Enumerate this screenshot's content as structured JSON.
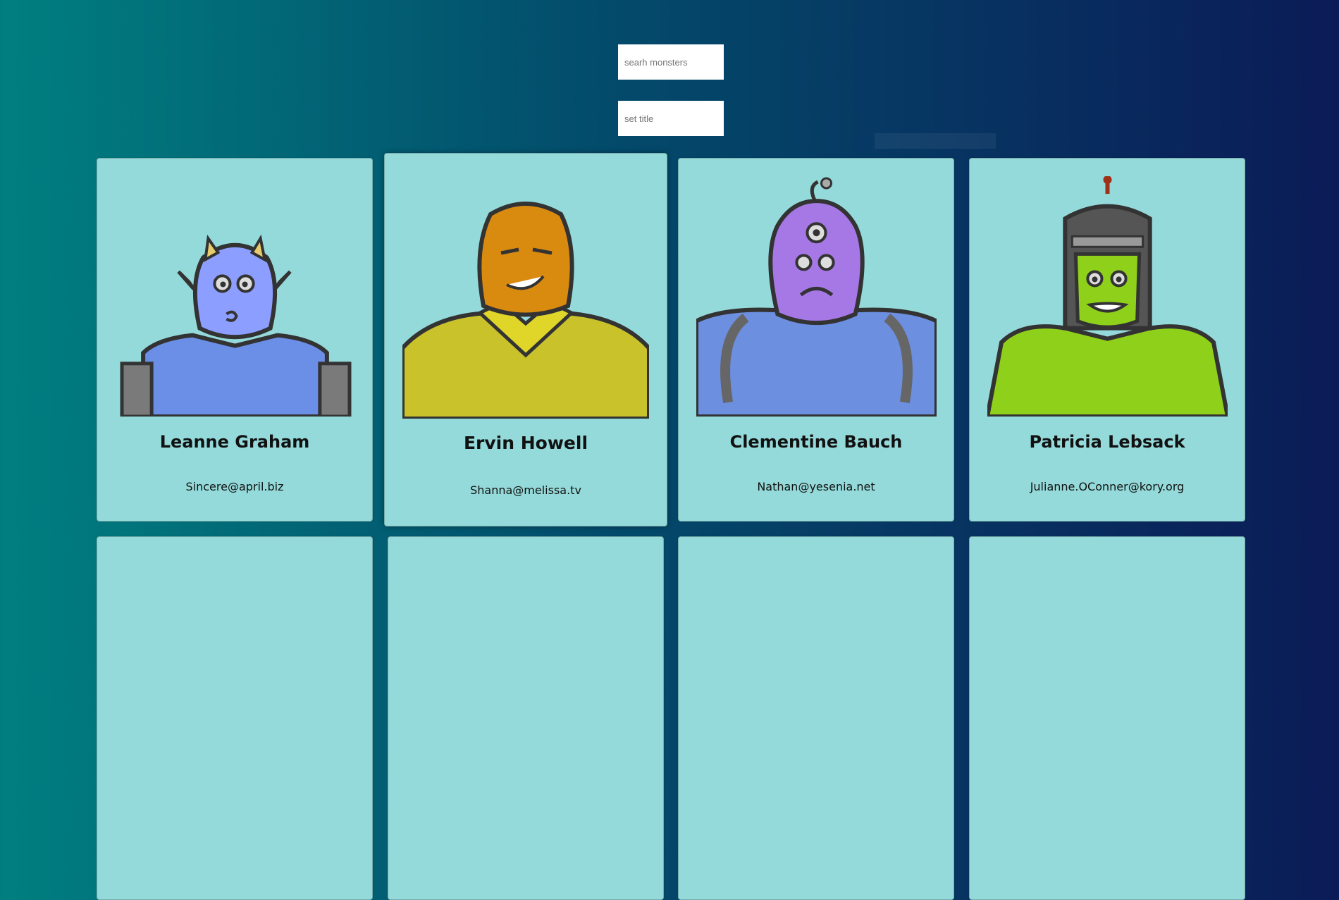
{
  "search": {
    "placeholder": "searh monsters"
  },
  "title_field": {
    "placeholder": "set title"
  },
  "monsters": [
    {
      "name": "Leanne Graham",
      "email": "Sincere@april.biz",
      "color": "#8c9eff"
    },
    {
      "name": "Ervin Howell",
      "email": "Shanna@melissa.tv",
      "color": "#d98b10"
    },
    {
      "name": "Clementine Bauch",
      "email": "Nathan@yesenia.net",
      "color": "#a678e6"
    },
    {
      "name": "Patricia Lebsack",
      "email": "Julianne.OConner@kory.org",
      "color": "#8fd11a"
    }
  ],
  "colors": {
    "card_bg": "#95dada",
    "gradient_start": "#007f80",
    "gradient_end": "#0b1b57"
  }
}
